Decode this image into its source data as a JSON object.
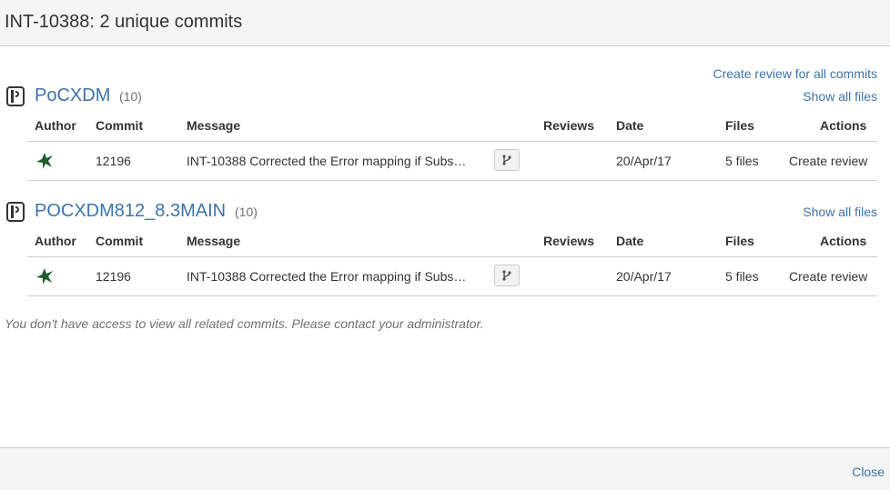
{
  "dialog": {
    "title": "INT-10388: 2 unique commits",
    "create_review_all": "Create review for all commits",
    "access_note": "You don't have access to view all related commits. Please contact your administrator.",
    "close_label": "Close"
  },
  "columns": {
    "author": "Author",
    "commit": "Commit",
    "message": "Message",
    "reviews": "Reviews",
    "date": "Date",
    "files": "Files",
    "actions": "Actions"
  },
  "repos": [
    {
      "name": "PoCXDM",
      "count": "(10)",
      "show_all": "Show all files",
      "commits": [
        {
          "id": "12196",
          "message": "INT-10388 Corrected the Error mapping if Subs…",
          "date": "20/Apr/17",
          "files": "5 files",
          "action": "Create review"
        }
      ]
    },
    {
      "name": "POCXDM812_8.3MAIN",
      "count": "(10)",
      "show_all": "Show all files",
      "commits": [
        {
          "id": "12196",
          "message": "INT-10388 Corrected the Error mapping if Subs…",
          "date": "20/Apr/17",
          "files": "5 files",
          "action": "Create review"
        }
      ]
    }
  ],
  "colors": {
    "link": "#3b73af",
    "avatar": "#1f5c2e"
  }
}
